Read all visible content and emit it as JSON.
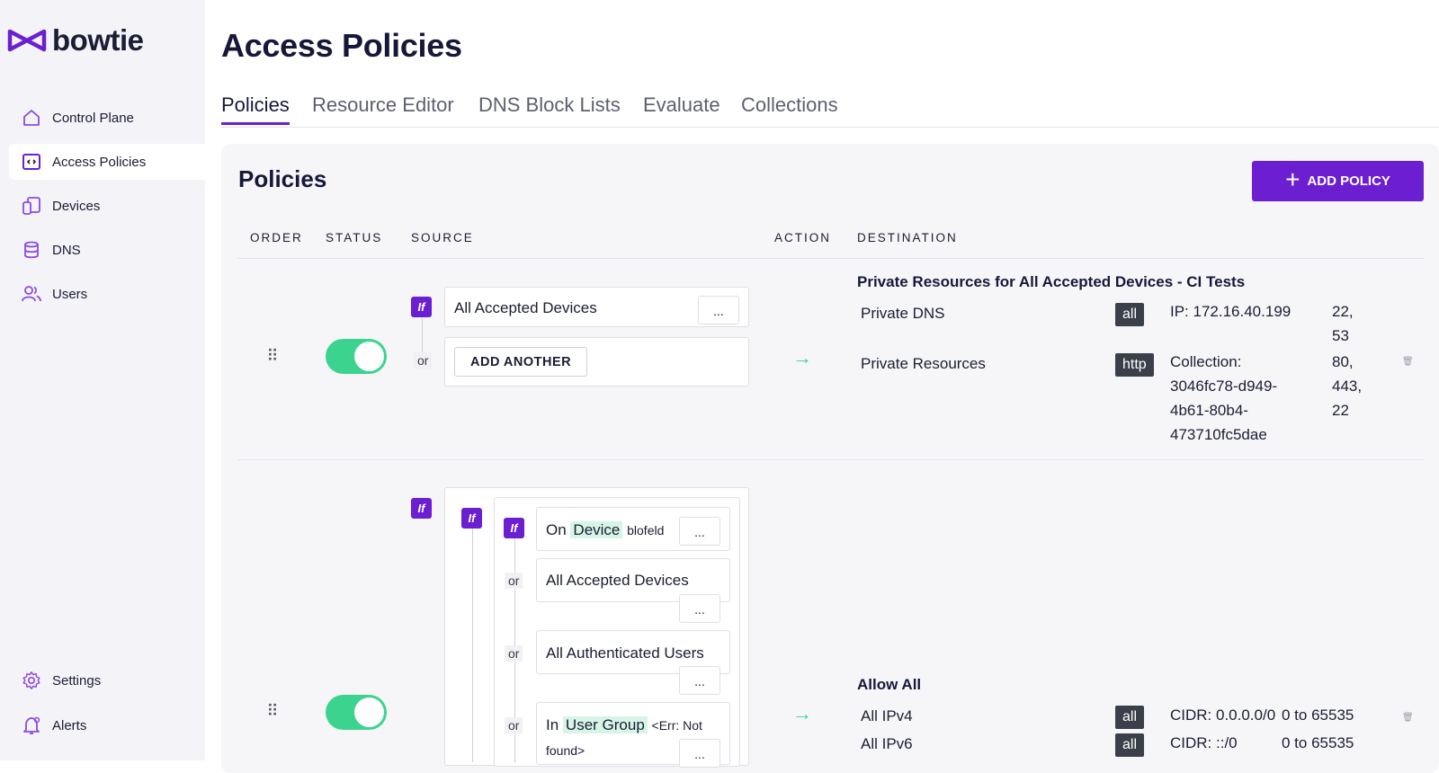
{
  "brand": {
    "name": "bowtie"
  },
  "sidebar": {
    "items": [
      {
        "label": "Control Plane",
        "icon": "home-icon",
        "active": false
      },
      {
        "label": "Access Policies",
        "icon": "code-window-icon",
        "active": true
      },
      {
        "label": "Devices",
        "icon": "devices-icon",
        "active": false
      },
      {
        "label": "DNS",
        "icon": "database-icon",
        "active": false
      },
      {
        "label": "Users",
        "icon": "users-icon",
        "active": false
      }
    ],
    "bottom_items": [
      {
        "label": "Settings",
        "icon": "gear-icon"
      },
      {
        "label": "Alerts",
        "icon": "bell-icon"
      }
    ]
  },
  "page": {
    "title": "Access Policies"
  },
  "tabs": [
    {
      "label": "Policies",
      "active": true
    },
    {
      "label": "Resource Editor",
      "active": false
    },
    {
      "label": "DNS Block Lists",
      "active": false
    },
    {
      "label": "Evaluate",
      "active": false
    },
    {
      "label": "Collections",
      "active": false
    }
  ],
  "policies_panel": {
    "title": "Policies",
    "add_button": "ADD POLICY",
    "columns": {
      "order": "ORDER",
      "status": "STATUS",
      "source": "SOURCE",
      "action": "ACTION",
      "destination": "DESTINATION"
    }
  },
  "policy1": {
    "enabled": true,
    "source": {
      "if_label": "If",
      "condition": "All Accepted Devices",
      "more": "...",
      "or_label": "or",
      "add_another": "ADD ANOTHER"
    },
    "destination": {
      "title": "Private Resources for All Accepted Devices - CI Tests",
      "rows": [
        {
          "name": "Private DNS",
          "protocol": "all",
          "target": "IP: 172.16.40.199",
          "ports": [
            "22,",
            "53"
          ]
        },
        {
          "name": "Private Resources",
          "protocol": "http",
          "target": [
            "Collection:",
            "3046fc78-d949-",
            "4b61-80b4-",
            "473710fc5dae"
          ],
          "ports": [
            "80,",
            "443,",
            "22"
          ]
        }
      ]
    }
  },
  "policy2": {
    "enabled": true,
    "source": {
      "if_label": "If",
      "or_label": "or",
      "more": "...",
      "conditions": {
        "c1_prefix": "On",
        "c1_highlight": "Device",
        "c1_suffix": "blofeld",
        "c2": "All Accepted Devices",
        "c3": "All Authenticated Users",
        "c4_prefix": "In",
        "c4_highlight": "User Group",
        "c4_suffix": "<Err: Not",
        "c4_suffix2": "found>"
      }
    },
    "destination": {
      "title": "Allow All",
      "rows": [
        {
          "name": "All IPv4",
          "protocol": "all",
          "target": "CIDR: 0.0.0.0/0",
          "ports": "0 to 65535"
        },
        {
          "name": "All IPv6",
          "protocol": "all",
          "target": "CIDR: ::/0",
          "ports": "0 to 65535"
        }
      ]
    }
  },
  "colors": {
    "accent": "#6b1fd1",
    "toggle_on": "#3cd38f",
    "highlight": "#d6f5e7"
  }
}
